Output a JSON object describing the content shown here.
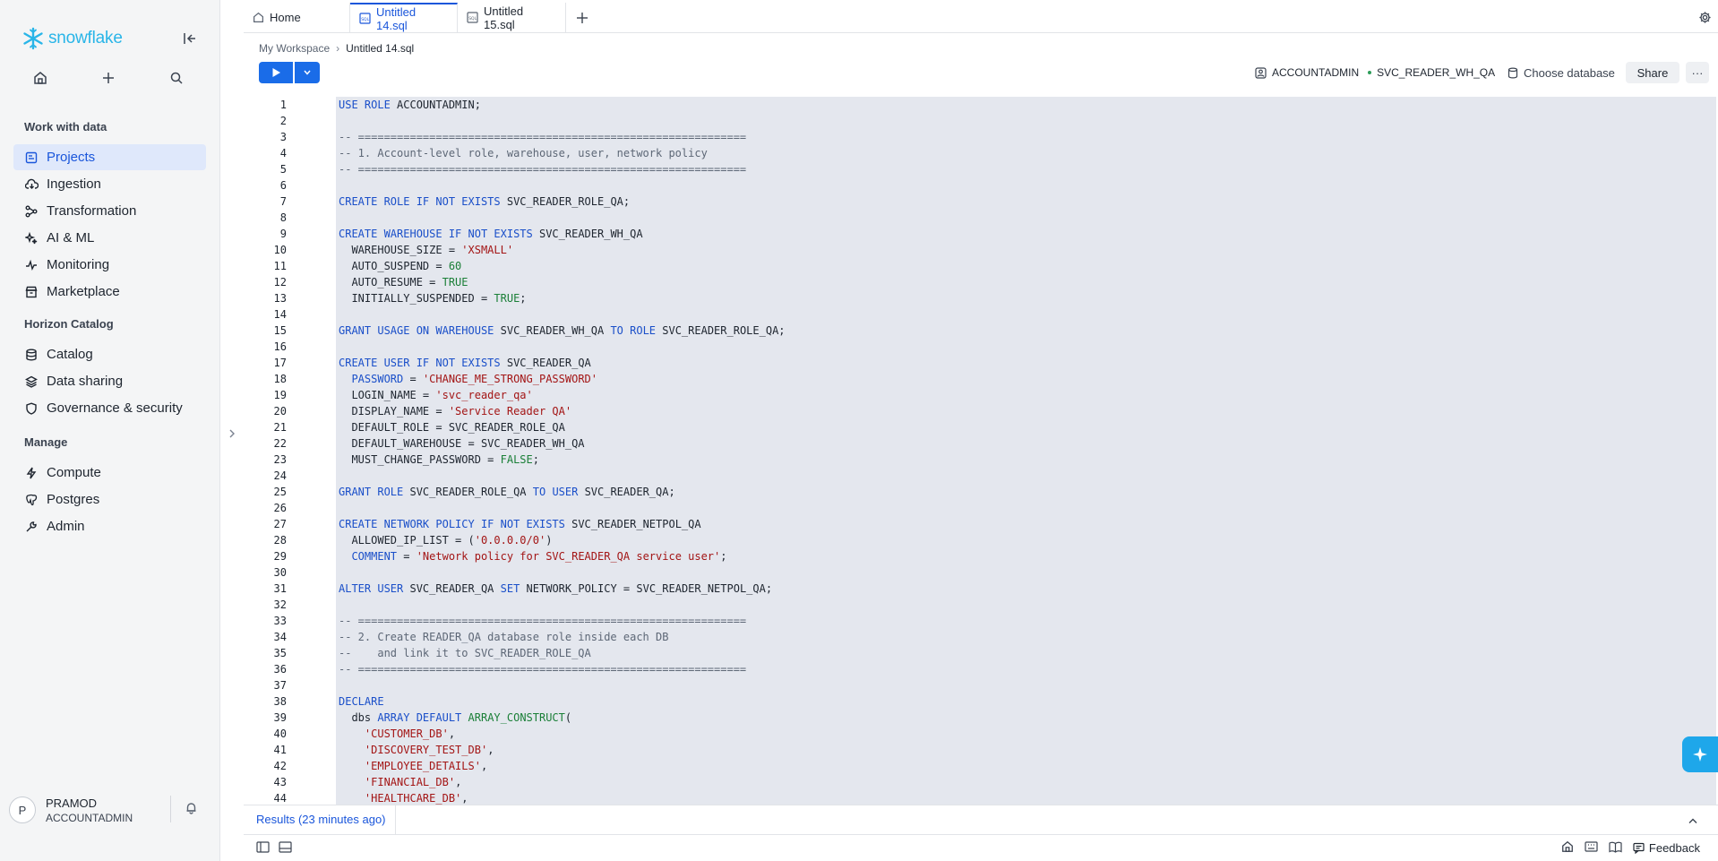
{
  "app": {
    "logo_text": "snowflake",
    "brand_color": "#29b5e8",
    "accent_color": "#1a6ce8"
  },
  "sidebar": {
    "sections": [
      {
        "heading": "Work with data",
        "items": [
          {
            "label": "Projects",
            "icon": "projects-icon",
            "active": true
          },
          {
            "label": "Ingestion",
            "icon": "ingestion-icon"
          },
          {
            "label": "Transformation",
            "icon": "transformation-icon"
          },
          {
            "label": "AI & ML",
            "icon": "ai-ml-icon"
          },
          {
            "label": "Monitoring",
            "icon": "monitoring-icon"
          },
          {
            "label": "Marketplace",
            "icon": "marketplace-icon"
          }
        ]
      },
      {
        "heading": "Horizon Catalog",
        "items": [
          {
            "label": "Catalog",
            "icon": "catalog-icon"
          },
          {
            "label": "Data sharing",
            "icon": "data-sharing-icon"
          },
          {
            "label": "Governance & security",
            "icon": "shield-icon"
          }
        ]
      },
      {
        "heading": "Manage",
        "items": [
          {
            "label": "Compute",
            "icon": "lightning-icon"
          },
          {
            "label": "Postgres",
            "icon": "postgres-icon"
          },
          {
            "label": "Admin",
            "icon": "admin-icon"
          }
        ]
      }
    ],
    "user": {
      "initial": "P",
      "name": "PRAMOD",
      "role": "ACCOUNTADMIN"
    }
  },
  "tabs": {
    "home": "Home",
    "active": "Untitled 14.sql",
    "other": "Untitled 15.sql"
  },
  "breadcrumb": {
    "root": "My Workspace",
    "current": "Untitled 14.sql"
  },
  "toolbar": {
    "role": "ACCOUNTADMIN",
    "warehouse": "SVC_READER_WH_QA",
    "database_placeholder": "Choose database",
    "share_label": "Share",
    "more_label": "···"
  },
  "editor": {
    "lines": [
      [
        [
          "kw",
          "USE ROLE "
        ],
        [
          "t",
          "ACCOUNTADMIN;"
        ]
      ],
      [],
      [
        [
          "cm",
          "-- ============================================================"
        ]
      ],
      [
        [
          "cm",
          "-- 1. Account-level role, warehouse, user, network policy"
        ]
      ],
      [
        [
          "cm",
          "-- ============================================================"
        ]
      ],
      [],
      [
        [
          "kw",
          "CREATE ROLE IF NOT EXISTS "
        ],
        [
          "t",
          "SVC_READER_ROLE_QA;"
        ]
      ],
      [],
      [
        [
          "kw",
          "CREATE WAREHOUSE IF NOT EXISTS "
        ],
        [
          "t",
          "SVC_READER_WH_QA"
        ]
      ],
      [
        [
          "t",
          "  WAREHOUSE_SIZE = "
        ],
        [
          "str",
          "'XSMALL'"
        ]
      ],
      [
        [
          "t",
          "  AUTO_SUSPEND = "
        ],
        [
          "num",
          "60"
        ]
      ],
      [
        [
          "t",
          "  AUTO_RESUME = "
        ],
        [
          "fn",
          "TRUE"
        ]
      ],
      [
        [
          "t",
          "  INITIALLY_SUSPENDED = "
        ],
        [
          "fn",
          "TRUE"
        ],
        [
          "t",
          ";"
        ]
      ],
      [],
      [
        [
          "kw",
          "GRANT USAGE ON WAREHOUSE "
        ],
        [
          "t",
          "SVC_READER_WH_QA "
        ],
        [
          "kw",
          "TO ROLE "
        ],
        [
          "t",
          "SVC_READER_ROLE_QA;"
        ]
      ],
      [],
      [
        [
          "kw",
          "CREATE USER IF NOT EXISTS "
        ],
        [
          "t",
          "SVC_READER_QA"
        ]
      ],
      [
        [
          "kw",
          "  PASSWORD "
        ],
        [
          "t",
          "= "
        ],
        [
          "str",
          "'CHANGE_ME_STRONG_PASSWORD'"
        ]
      ],
      [
        [
          "t",
          "  LOGIN_NAME = "
        ],
        [
          "str",
          "'svc_reader_qa'"
        ]
      ],
      [
        [
          "t",
          "  DISPLAY_NAME = "
        ],
        [
          "str",
          "'Service Reader QA'"
        ]
      ],
      [
        [
          "t",
          "  DEFAULT_ROLE = SVC_READER_ROLE_QA"
        ]
      ],
      [
        [
          "t",
          "  DEFAULT_WAREHOUSE = SVC_READER_WH_QA"
        ]
      ],
      [
        [
          "t",
          "  MUST_CHANGE_PASSWORD = "
        ],
        [
          "fn",
          "FALSE"
        ],
        [
          "t",
          ";"
        ]
      ],
      [],
      [
        [
          "kw",
          "GRANT ROLE "
        ],
        [
          "t",
          "SVC_READER_ROLE_QA "
        ],
        [
          "kw",
          "TO USER "
        ],
        [
          "t",
          "SVC_READER_QA;"
        ]
      ],
      [],
      [
        [
          "kw",
          "CREATE NETWORK POLICY IF NOT EXISTS "
        ],
        [
          "t",
          "SVC_READER_NETPOL_QA"
        ]
      ],
      [
        [
          "t",
          "  ALLOWED_IP_LIST = ("
        ],
        [
          "str",
          "'0.0.0.0/0'"
        ],
        [
          "t",
          ")"
        ]
      ],
      [
        [
          "kw",
          "  COMMENT "
        ],
        [
          "t",
          "= "
        ],
        [
          "str",
          "'Network policy for SVC_READER_QA service user'"
        ],
        [
          "t",
          ";"
        ]
      ],
      [],
      [
        [
          "kw",
          "ALTER USER "
        ],
        [
          "t",
          "SVC_READER_QA "
        ],
        [
          "kw",
          "SET "
        ],
        [
          "t",
          "NETWORK_POLICY = SVC_READER_NETPOL_QA;"
        ]
      ],
      [],
      [
        [
          "cm",
          "-- ============================================================"
        ]
      ],
      [
        [
          "cm",
          "-- 2. Create READER_QA database role inside each DB"
        ]
      ],
      [
        [
          "cm",
          "--    and link it to SVC_READER_ROLE_QA"
        ]
      ],
      [
        [
          "cm",
          "-- ============================================================"
        ]
      ],
      [],
      [
        [
          "kw",
          "DECLARE"
        ]
      ],
      [
        [
          "t",
          "  dbs "
        ],
        [
          "kw",
          "ARRAY DEFAULT "
        ],
        [
          "fn",
          "ARRAY_CONSTRUCT"
        ],
        [
          "t",
          "("
        ]
      ],
      [
        [
          "t",
          "    "
        ],
        [
          "str",
          "'CUSTOMER_DB'"
        ],
        [
          "t",
          ","
        ]
      ],
      [
        [
          "t",
          "    "
        ],
        [
          "str",
          "'DISCOVERY_TEST_DB'"
        ],
        [
          "t",
          ","
        ]
      ],
      [
        [
          "t",
          "    "
        ],
        [
          "str",
          "'EMPLOYEE_DETAILS'"
        ],
        [
          "t",
          ","
        ]
      ],
      [
        [
          "t",
          "    "
        ],
        [
          "str",
          "'FINANCIAL_DB'"
        ],
        [
          "t",
          ","
        ]
      ],
      [
        [
          "t",
          "    "
        ],
        [
          "str",
          "'HEALTHCARE_DB'"
        ],
        [
          "t",
          ","
        ]
      ]
    ]
  },
  "results": {
    "label": "Results (23 minutes ago)"
  },
  "statusbar": {
    "feedback_label": "Feedback"
  }
}
